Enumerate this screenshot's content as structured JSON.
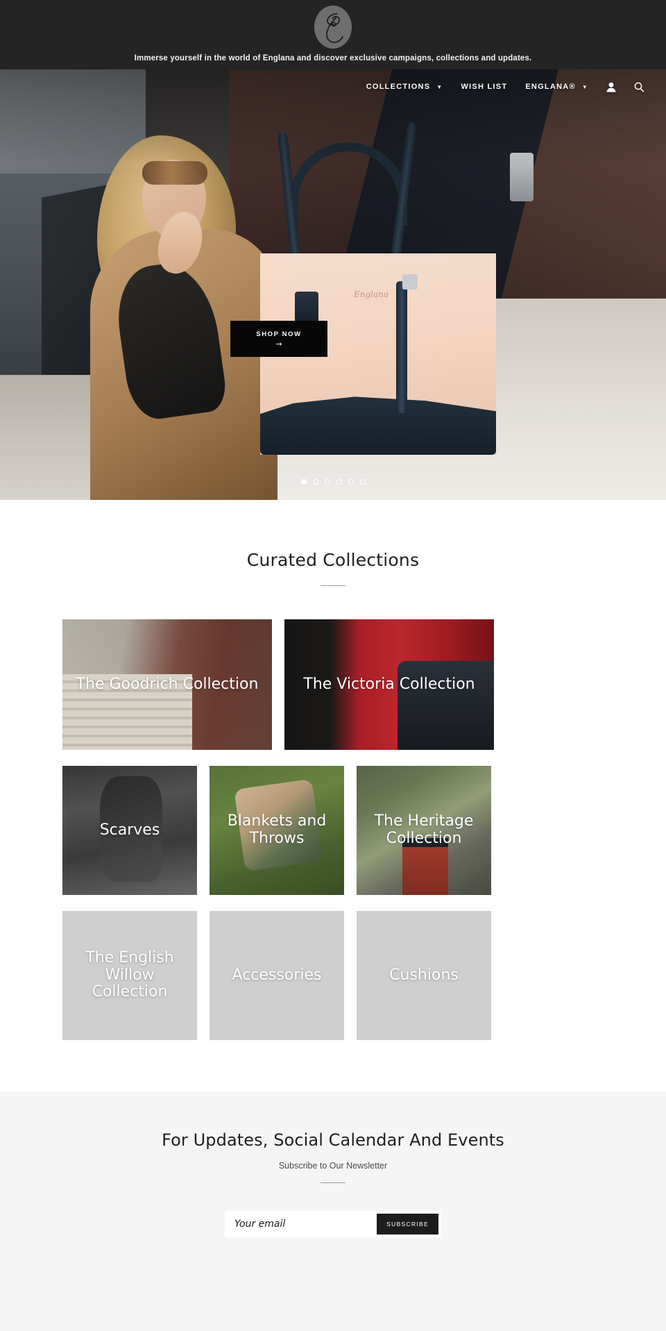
{
  "topbar": {
    "logo_icon": "englana-monogram-logo",
    "tagline": "Immerse yourself in the world of Englana and discover exclusive campaigns, collections and updates."
  },
  "nav": {
    "items": [
      {
        "label": "COLLECTIONS",
        "has_dropdown": true,
        "caret": "▼"
      },
      {
        "label": "WISH LIST",
        "has_dropdown": false,
        "caret": ""
      },
      {
        "label": "ENGLANA®",
        "has_dropdown": true,
        "caret": "▼"
      }
    ],
    "icons": [
      {
        "name": "account-icon",
        "glyph": "user"
      },
      {
        "name": "search-icon",
        "glyph": "magnifier"
      }
    ]
  },
  "hero": {
    "cta_label": "SHOP NOW",
    "cta_arrow": "→",
    "slides_total": 6,
    "active_slide": 1,
    "bag_logo_text": "Englana"
  },
  "collections": {
    "title": "Curated Collections",
    "tiles": [
      {
        "label": "The Goodrich Collection",
        "art": "art-goodrich",
        "size": "wide"
      },
      {
        "label": "The Victoria Collection",
        "art": "art-victoria",
        "size": "wide"
      },
      {
        "label": "Scarves",
        "art": "art-scarves",
        "size": "small"
      },
      {
        "label": "Blankets and Throws",
        "art": "art-blankets",
        "size": "small"
      },
      {
        "label": "The Heritage Collection",
        "art": "art-heritage",
        "size": "small"
      },
      {
        "label": "The English Willow Collection",
        "art": "plain",
        "size": "small"
      },
      {
        "label": "Accessories",
        "art": "plain",
        "size": "small"
      },
      {
        "label": "Cushions",
        "art": "plain",
        "size": "small"
      }
    ]
  },
  "newsletter": {
    "title": "For Updates, Social Calendar And Events",
    "subtitle": "Subscribe to Our Newsletter",
    "email_placeholder": "Your email",
    "email_value": "",
    "button_label": "SUBSCRIBE"
  },
  "colors": {
    "topbar_bg": "#242424",
    "cta_bg": "#070707",
    "newsletter_bg": "#f5f5f5",
    "tile_placeholder": "#cfcfcf",
    "text_dark": "#1f1f1f"
  }
}
